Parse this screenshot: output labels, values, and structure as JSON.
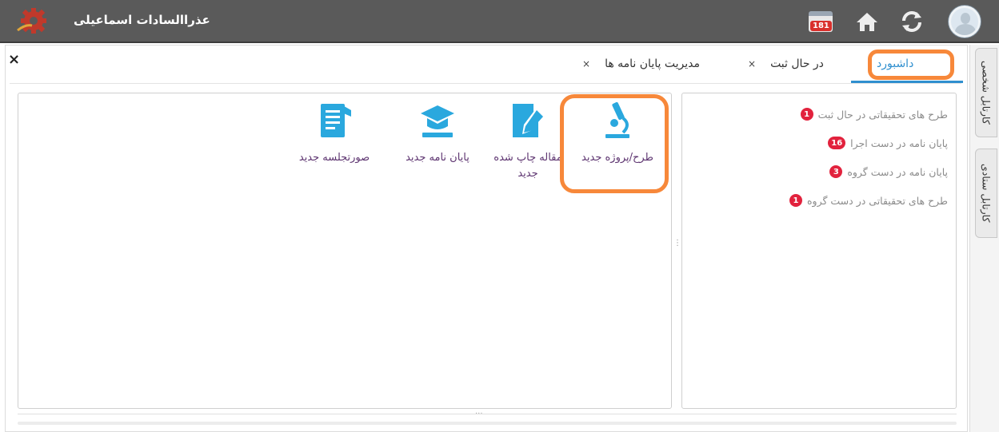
{
  "header": {
    "user_name": "عذراالسادات اسماعیلی",
    "calendar_badge": "181",
    "icons": [
      "logo-gear-icon",
      "calendar-icon",
      "home-icon",
      "refresh-icon",
      "user-avatar-icon"
    ]
  },
  "tabs": [
    {
      "label": "داشبورد",
      "active": true
    },
    {
      "label": "در حال ثبت",
      "close": "×"
    },
    {
      "label": "مدیریت پایان نامه ها",
      "close": "×"
    }
  ],
  "close_all": "×",
  "shortcuts": [
    {
      "label": "طرح/پروژه جدید",
      "icon": "microscope-icon"
    },
    {
      "label": "مقاله چاپ شده جدید",
      "icon": "edit-document-icon"
    },
    {
      "label": "پایان نامه جدید",
      "icon": "graduation-cap-icon"
    },
    {
      "label": "صورتجلسه جدید",
      "icon": "minutes-document-icon"
    }
  ],
  "status_items": [
    {
      "label": "طرح های تحقیقاتی در حال ثبت",
      "count": "1"
    },
    {
      "label": "پایان نامه در دست اجرا",
      "count": "16"
    },
    {
      "label": "پایان نامه در دست گروه",
      "count": "3"
    },
    {
      "label": "طرح های تحقیقاتی در دست گروه",
      "count": "1"
    }
  ],
  "side_tabs": [
    {
      "label": "کارتابل شخصی"
    },
    {
      "label": "کارتابل ستادی"
    }
  ],
  "colors": {
    "topbar": "#5a5a5a",
    "accent": "#2f8fcf",
    "icon": "#2aa8de",
    "highlight": "#f7883a",
    "badge": "#e2223d",
    "shortcut_text": "#5d3470"
  }
}
